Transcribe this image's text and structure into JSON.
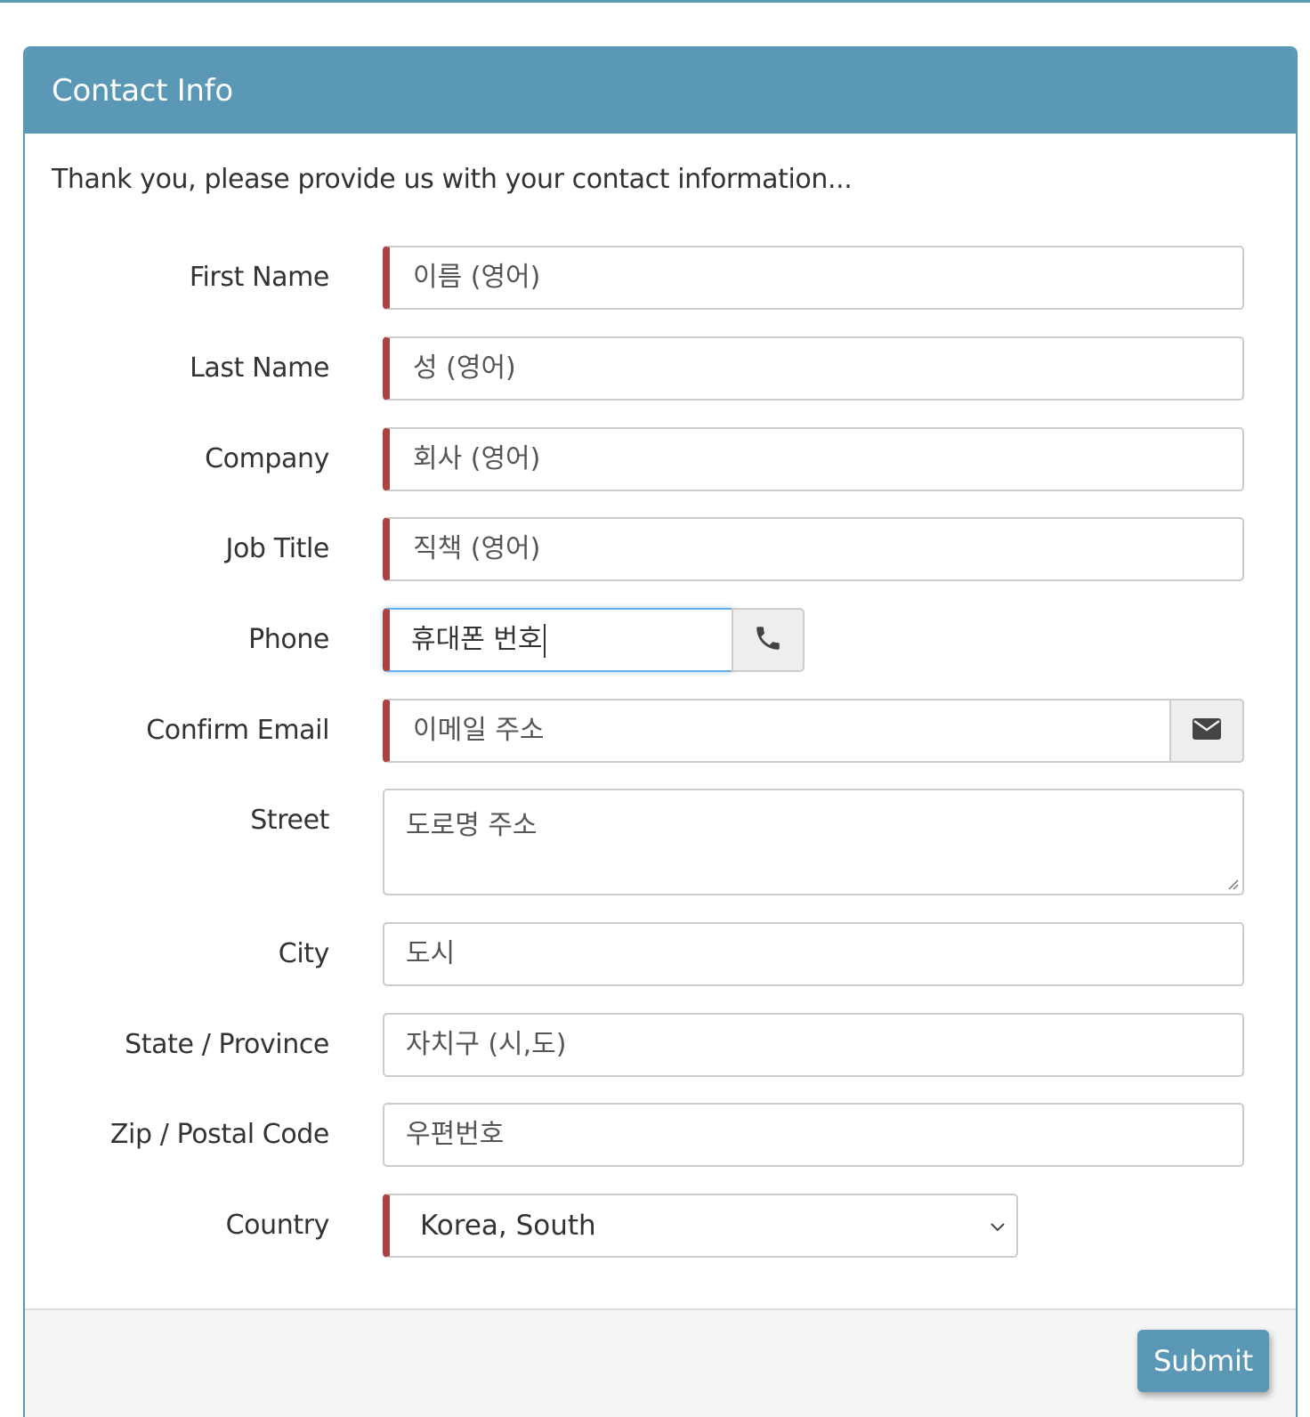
{
  "panel": {
    "title": "Contact Info",
    "intro": "Thank you, please provide us with your contact information..."
  },
  "fields": {
    "first_name": {
      "label": "First Name",
      "placeholder": "이름 (영어)"
    },
    "last_name": {
      "label": "Last Name",
      "placeholder": "성 (영어)"
    },
    "company": {
      "label": "Company",
      "placeholder": "회사 (영어)"
    },
    "job_title": {
      "label": "Job Title",
      "placeholder": "직책 (영어)"
    },
    "phone": {
      "label": "Phone",
      "value": "휴대폰 번호"
    },
    "email": {
      "label": "Confirm Email",
      "placeholder": "이메일 주소"
    },
    "street": {
      "label": "Street",
      "placeholder": "도로명 주소"
    },
    "city": {
      "label": "City",
      "placeholder": "도시"
    },
    "state": {
      "label": "State / Province",
      "placeholder": "자치구 (시,도)"
    },
    "zip": {
      "label": "Zip / Postal Code",
      "placeholder": "우편번호"
    },
    "country": {
      "label": "Country",
      "selected": "Korea, South"
    }
  },
  "footer": {
    "submit_label": "Submit"
  },
  "icons": {
    "phone": "phone-icon",
    "email": "envelope-icon",
    "select": "chevron-down-icon"
  },
  "colors": {
    "primary": "#5a98b5",
    "required": "#a94442",
    "focus": "#66afe9"
  }
}
